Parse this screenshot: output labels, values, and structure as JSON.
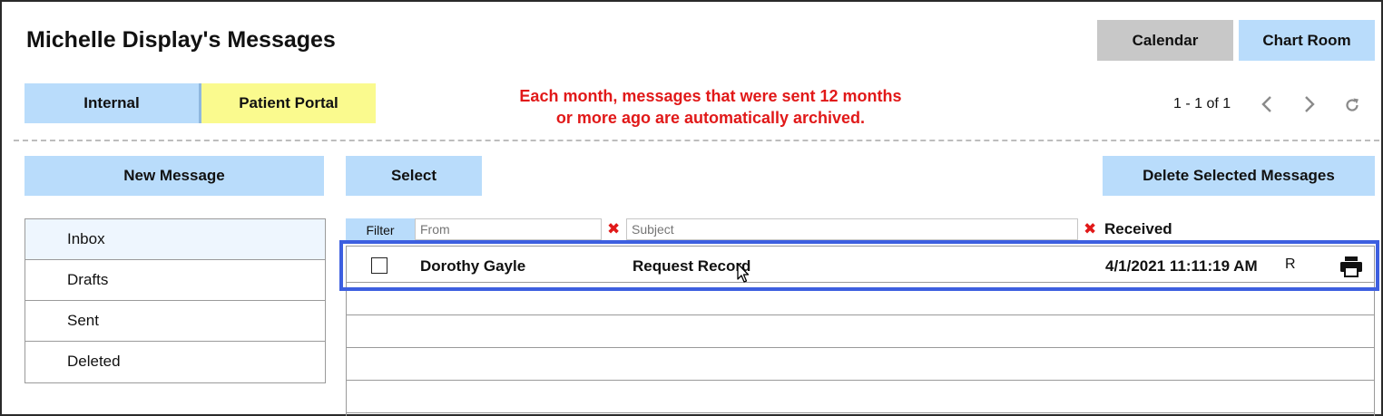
{
  "header": {
    "title": "Michelle Display's Messages"
  },
  "top_buttons": {
    "calendar": "Calendar",
    "chart_room": "Chart Room"
  },
  "tabs": {
    "internal": "Internal",
    "patient_portal": "Patient Portal"
  },
  "notice": {
    "line1": "Each month, messages that were sent 12 months",
    "line2": "or more ago are automatically archived."
  },
  "pager": {
    "text": "1 - 1 of 1"
  },
  "toolbar": {
    "new_message": "New Message",
    "select": "Select",
    "delete_selected": "Delete Selected Messages"
  },
  "folders": [
    {
      "label": "Inbox",
      "active": true
    },
    {
      "label": "Drafts"
    },
    {
      "label": "Sent"
    },
    {
      "label": "Deleted"
    }
  ],
  "filters": {
    "filter_label": "Filter",
    "from_placeholder": "From",
    "subject_placeholder": "Subject",
    "received_label": "Received"
  },
  "messages": [
    {
      "from": "Dorothy Gayle",
      "subject": "Request Record",
      "received": "4/1/2021 11:11:19 AM",
      "flag": "R"
    }
  ],
  "colors": {
    "button_blue": "#b9dcfb",
    "portal_yellow": "#fafa8e",
    "notice_red": "#e11919",
    "highlight_blue": "#3d5fe0"
  },
  "icons": {
    "prev": "chevron-left-icon",
    "next": "chevron-right-icon",
    "refresh": "refresh-icon",
    "print": "printer-icon"
  }
}
